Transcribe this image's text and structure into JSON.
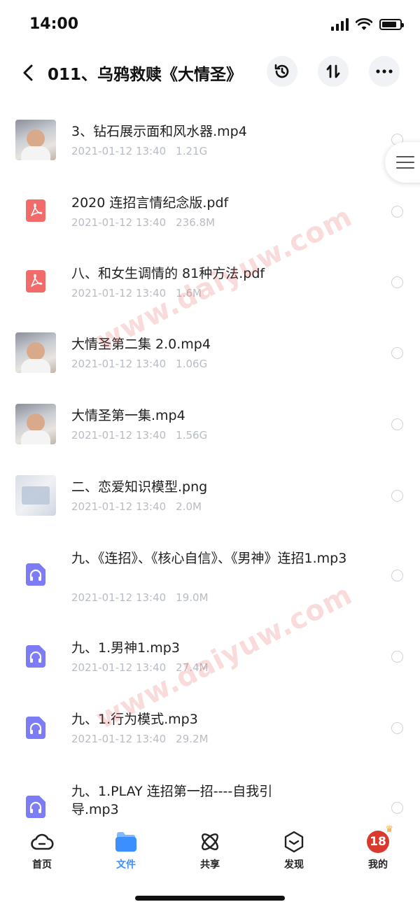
{
  "status_bar": {
    "time": "14:00"
  },
  "header": {
    "title": "011、乌鸦救赎《大情圣》"
  },
  "files": [
    {
      "name": "3、钻石展示面和风水器.mp4",
      "date": "2021-01-12 13:40",
      "size": "1.21G",
      "type": "video"
    },
    {
      "name": "2020 连招言情纪念版.pdf",
      "date": "2021-01-12 13:40",
      "size": "236.8M",
      "type": "pdf"
    },
    {
      "name": "八、和女生调情的 81种方法.pdf",
      "date": "2021-01-12 13:40",
      "size": "1.6M",
      "type": "pdf"
    },
    {
      "name": "大情圣第二集 2.0.mp4",
      "date": "2021-01-12 13:40",
      "size": "1.06G",
      "type": "video"
    },
    {
      "name": "大情圣第一集.mp4",
      "date": "2021-01-12 13:40",
      "size": "1.56G",
      "type": "video"
    },
    {
      "name": "二、恋爱知识模型.png",
      "date": "2021-01-12 13:40",
      "size": "2.0M",
      "type": "image"
    },
    {
      "name": "九、《连招》、《核心自信》、《男神》连招1.mp3",
      "date": "2021-01-12 13:40",
      "size": "19.0M",
      "type": "audio"
    },
    {
      "name": "九、1.男神1.mp3",
      "date": "2021-01-12 13:40",
      "size": "27.4M",
      "type": "audio"
    },
    {
      "name": "九、1.行为模式.mp3",
      "date": "2021-01-12 13:40",
      "size": "29.2M",
      "type": "audio"
    },
    {
      "name": "九、1.PLAY 连招第一招----自我引导.mp3",
      "date": "",
      "size": "",
      "type": "audio"
    }
  ],
  "watermark": "www.daiyuw.com",
  "tab_bar": {
    "items": [
      {
        "label": "首页",
        "icon": "cloud-icon",
        "active": false
      },
      {
        "label": "文件",
        "icon": "folder-icon",
        "active": true
      },
      {
        "label": "共享",
        "icon": "atom-icon",
        "active": false
      },
      {
        "label": "发现",
        "icon": "compass-icon",
        "active": false
      },
      {
        "label": "我的",
        "icon": "avatar",
        "active": false
      }
    ],
    "avatar_text": "18"
  },
  "colors": {
    "accent": "#3b8fff",
    "pdf": "#f26b6b",
    "audio": "#7b7cf6",
    "watermark": "#e95a5a"
  }
}
